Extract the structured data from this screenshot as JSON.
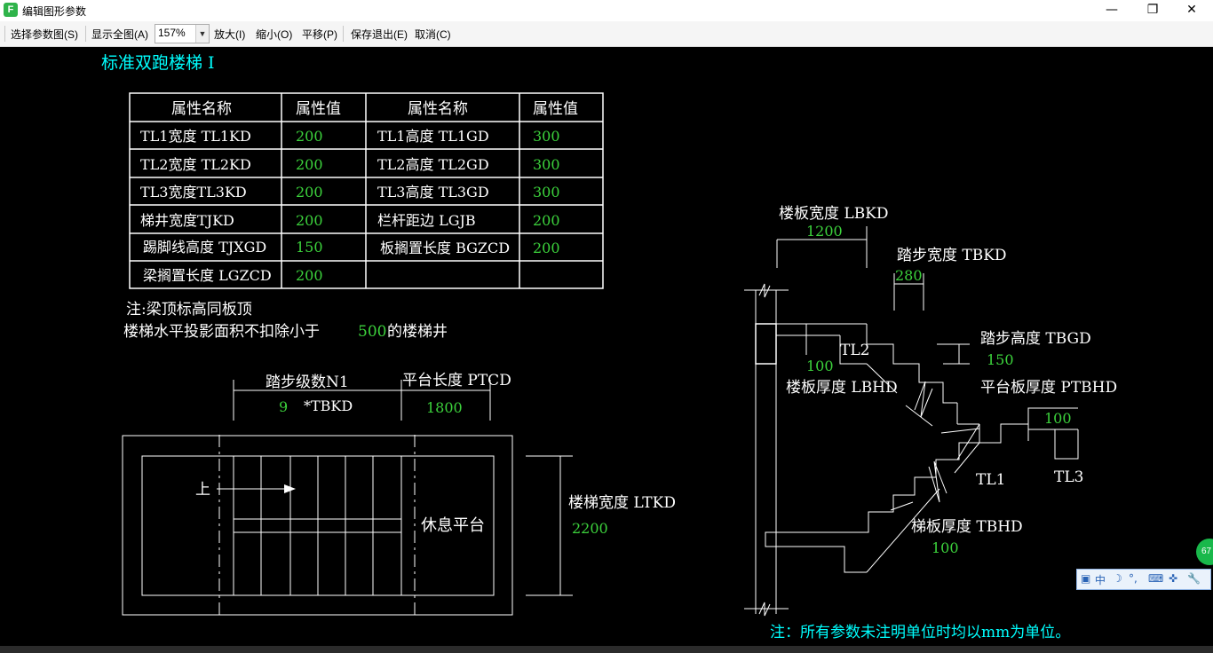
{
  "window": {
    "title": "编辑图形参数",
    "app_icon": "F",
    "minimize_glyph": "—",
    "maximize_glyph": "❐",
    "close_glyph": "✕"
  },
  "toolbar": {
    "select_diagram": "选择参数图(S)",
    "show_all": "显示全图(A)",
    "zoom_value": "157%",
    "zoom_in": "放大(I)",
    "zoom_out": "缩小(O)",
    "pan": "平移(P)",
    "save_exit": "保存退出(E)",
    "cancel": "取消(C)"
  },
  "drawing": {
    "title": "标准双跑楼梯 I",
    "table": {
      "headers": [
        "属性名称",
        "属性值",
        "属性名称",
        "属性值"
      ],
      "rows": [
        [
          "TL1宽度 TL1KD",
          "200",
          "TL1高度 TL1GD",
          "300"
        ],
        [
          "TL2宽度 TL2KD",
          "200",
          "TL2高度 TL2GD",
          "300"
        ],
        [
          "TL3宽度TL3KD",
          "200",
          "TL3高度 TL3GD",
          "300"
        ],
        [
          "梯井宽度TJKD",
          "200",
          "栏杆距边 LGJB",
          "200"
        ],
        [
          "踢脚线高度 TJXGD",
          "150",
          "板搁置长度 BGZCD",
          "200"
        ],
        [
          "梁搁置长度 LGZCD",
          "200",
          "",
          ""
        ]
      ]
    },
    "notes": {
      "note1": "注:梁顶标高同板顶",
      "note2_prefix": "楼梯水平投影面积不扣除小于",
      "note2_value": "500",
      "note2_suffix": "的楼梯井"
    },
    "plan": {
      "steps_label": "踏步级数N1",
      "steps_value": "9",
      "steps_mult": "*TBKD",
      "platform_length_label": "平台长度 PTCD",
      "platform_length_value": "1800",
      "up_label": "上",
      "rest_platform": "休息平台",
      "stair_width_label": "楼梯宽度 LTKD",
      "stair_width_value": "2200"
    },
    "section": {
      "slab_width_label": "楼板宽度 LBKD",
      "slab_width_value": "1200",
      "tread_width_label": "踏步宽度 TBKD",
      "tread_width_value": "280",
      "tread_height_label": "踏步高度 TBGD",
      "tread_height_value": "150",
      "tl2": "TL2",
      "slab_thk_value": "100",
      "slab_thk_label": "楼板厚度 LBHD",
      "platform_slab_label": "平台板厚度 PTBHD",
      "platform_slab_value": "100",
      "tl1": "TL1",
      "tl3": "TL3",
      "stair_slab_label": "梯板厚度 TBHD",
      "stair_slab_value": "100"
    },
    "footer_note": "注：所有参数未注明单位时均以mm为单位。"
  },
  "ime": {
    "lang": "中",
    "moon": "☽",
    "punct": "°,",
    "keyboard": "⌨",
    "tools": "✜",
    "wrench": "🔧"
  },
  "badge": {
    "value": "67"
  },
  "colors": {
    "cad_white": "#ffffff",
    "cad_green": "#3cd23c",
    "cad_cyan": "#00ffff",
    "background": "#000000"
  }
}
